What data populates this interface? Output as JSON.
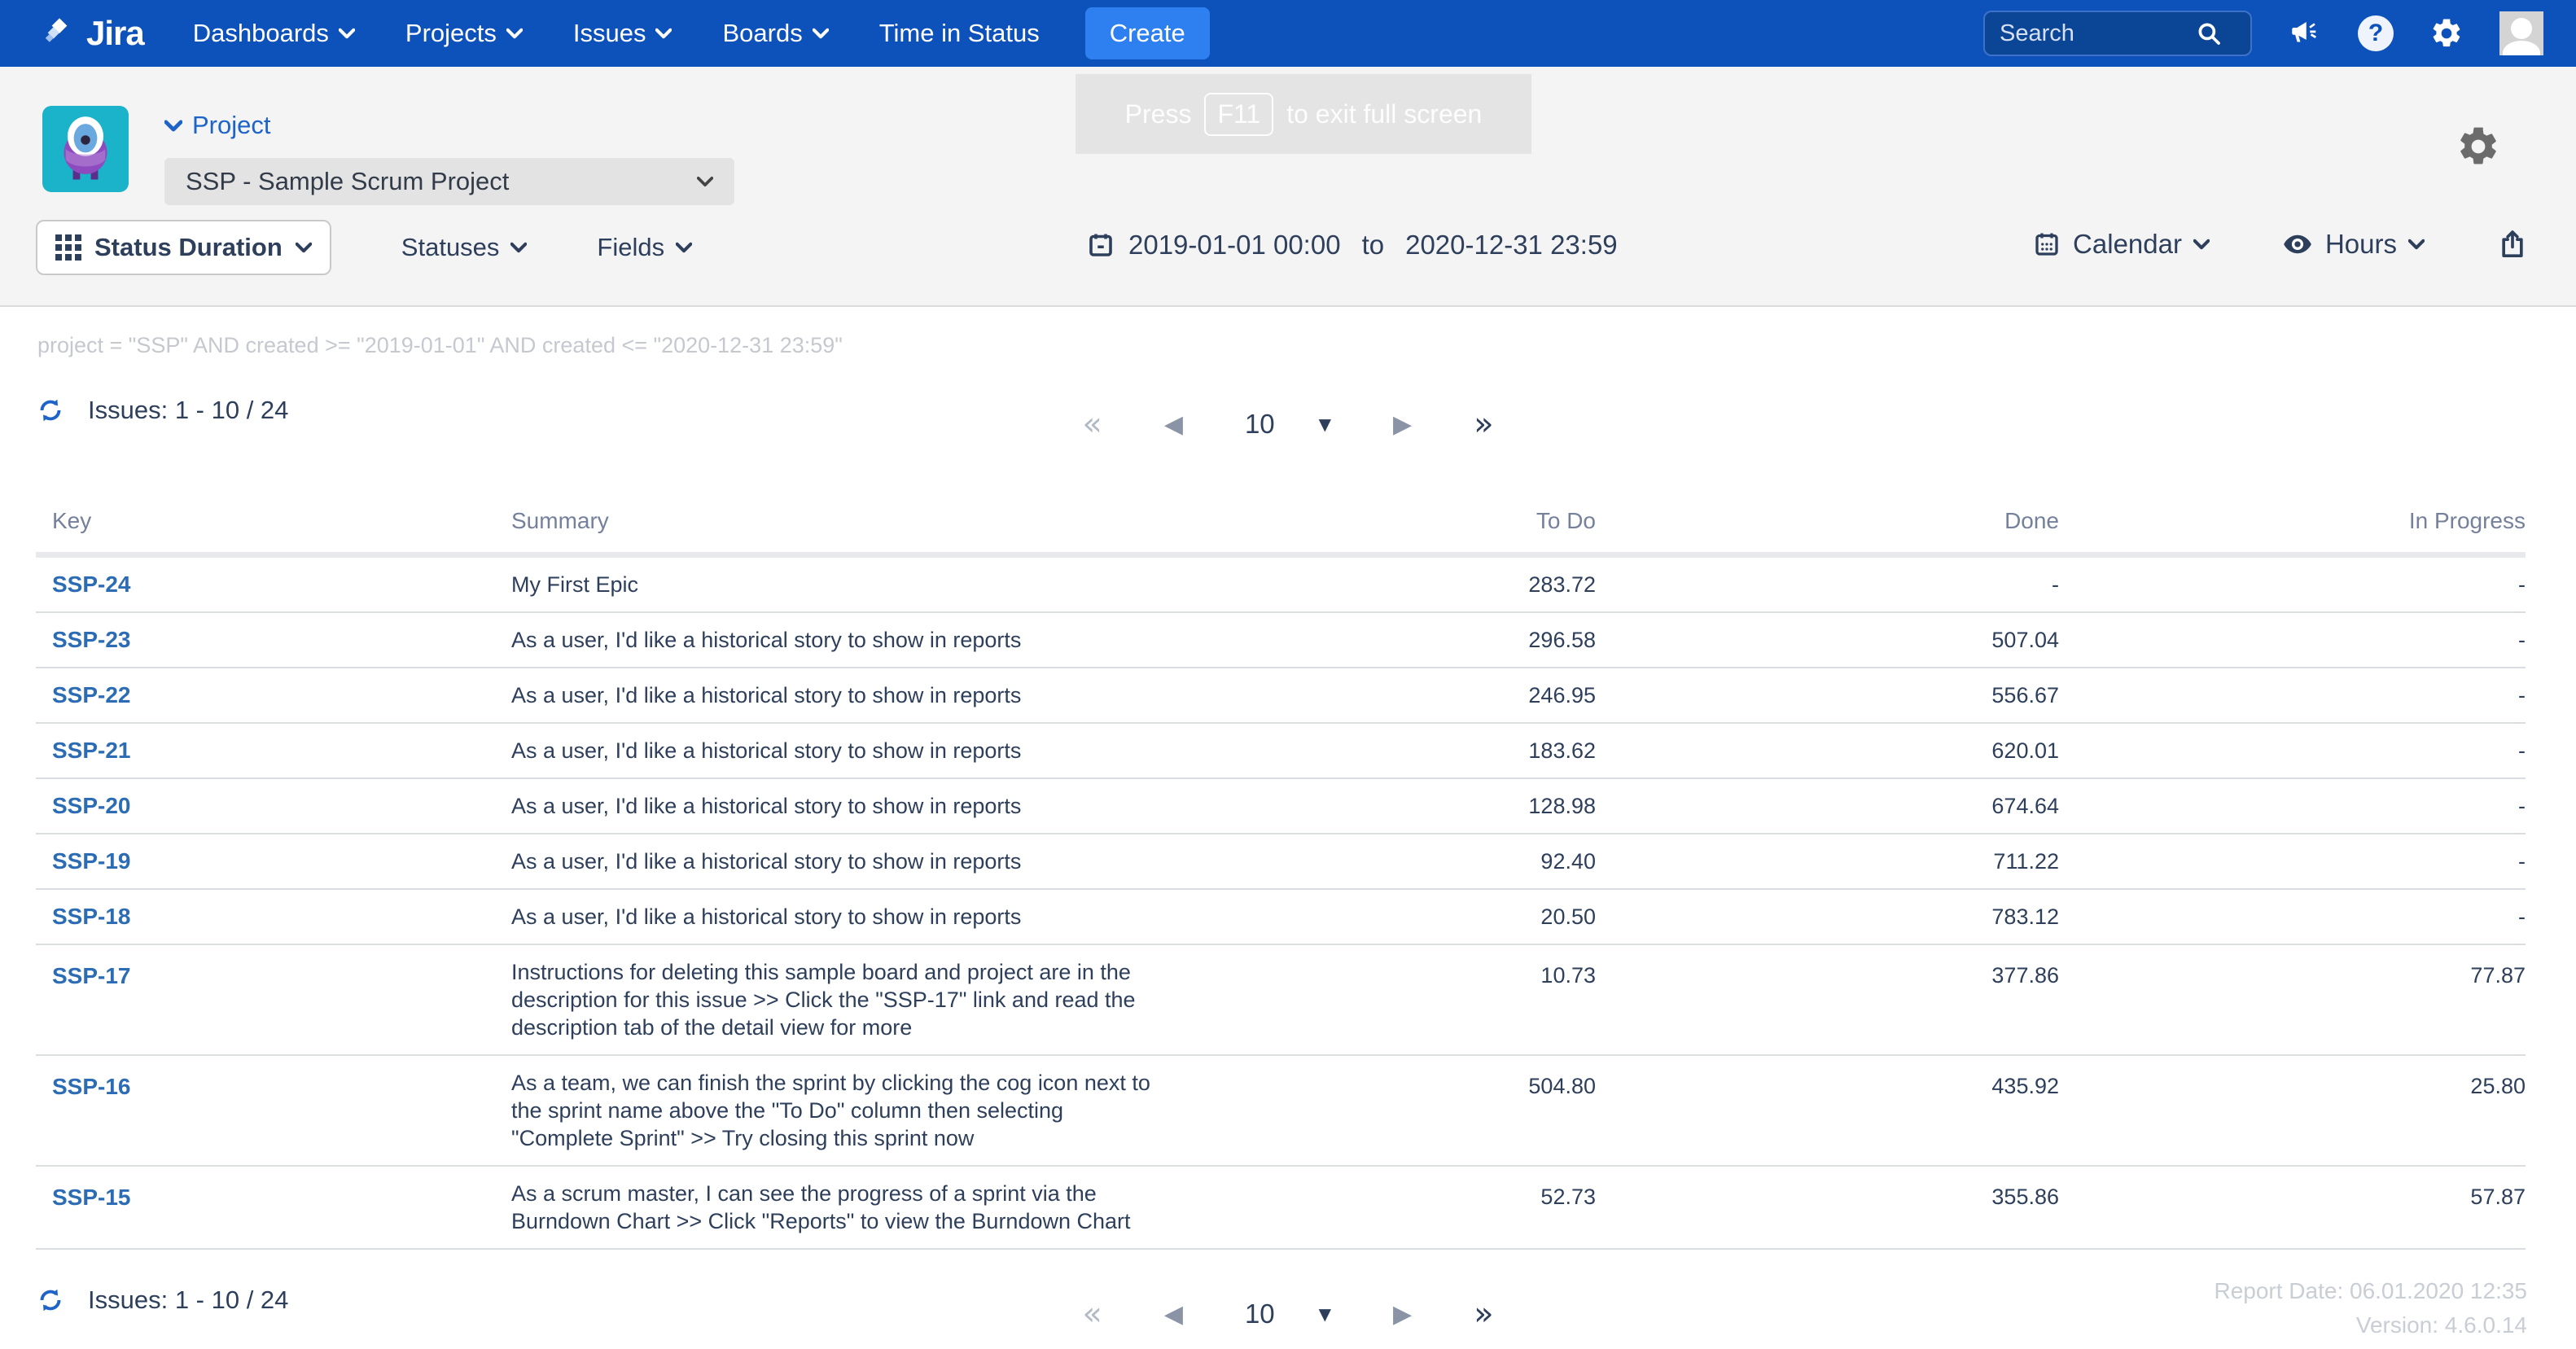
{
  "nav": {
    "brand": "Jira",
    "items": [
      {
        "label": "Dashboards"
      },
      {
        "label": "Projects"
      },
      {
        "label": "Issues"
      },
      {
        "label": "Boards"
      },
      {
        "label": "Time in Status"
      }
    ],
    "create_label": "Create",
    "search_placeholder": "Search"
  },
  "fullscreen_toast": {
    "pre": "Press",
    "key": "F11",
    "post": "to exit full screen"
  },
  "project": {
    "label": "Project",
    "selected": "SSP - Sample Scrum Project"
  },
  "toolbar": {
    "report_type": "Status Duration",
    "statuses_label": "Statuses",
    "fields_label": "Fields",
    "date_from": "2019-01-01 00:00",
    "to_word": "to",
    "date_to": "2020-12-31 23:59",
    "calendar_label": "Calendar",
    "hours_label": "Hours"
  },
  "query": "project = \"SSP\" AND created >= \"2019-01-01\" AND created <= \"2020-12-31 23:59\"",
  "issues_count": "Issues: 1 - 10 / 24",
  "pagination": {
    "page_size": "10",
    "first": "«",
    "prev": "◀",
    "next": "▶",
    "last": "»",
    "caret": "▼"
  },
  "table": {
    "columns": {
      "key": "Key",
      "summary": "Summary",
      "todo": "To Do",
      "done": "Done",
      "inprogress": "In Progress"
    },
    "rows": [
      {
        "key": "SSP-24",
        "summary": "My First Epic",
        "todo": "283.72",
        "done": "-",
        "inprog": "-"
      },
      {
        "key": "SSP-23",
        "summary": "As a user, I'd like a historical story to show in reports",
        "todo": "296.58",
        "done": "507.04",
        "inprog": "-"
      },
      {
        "key": "SSP-22",
        "summary": "As a user, I'd like a historical story to show in reports",
        "todo": "246.95",
        "done": "556.67",
        "inprog": "-"
      },
      {
        "key": "SSP-21",
        "summary": "As a user, I'd like a historical story to show in reports",
        "todo": "183.62",
        "done": "620.01",
        "inprog": "-"
      },
      {
        "key": "SSP-20",
        "summary": "As a user, I'd like a historical story to show in reports",
        "todo": "128.98",
        "done": "674.64",
        "inprog": "-"
      },
      {
        "key": "SSP-19",
        "summary": "As a user, I'd like a historical story to show in reports",
        "todo": "92.40",
        "done": "711.22",
        "inprog": "-"
      },
      {
        "key": "SSP-18",
        "summary": "As a user, I'd like a historical story to show in reports",
        "todo": "20.50",
        "done": "783.12",
        "inprog": "-"
      },
      {
        "key": "SSP-17",
        "summary": "Instructions for deleting this sample board and project are in the description for this issue >> Click the \"SSP-17\" link and read the description tab of the detail view for more",
        "todo": "10.73",
        "done": "377.86",
        "inprog": "77.87"
      },
      {
        "key": "SSP-16",
        "summary": "As a team, we can finish the sprint by clicking the cog icon next to the sprint name above the \"To Do\" column then selecting \"Complete Sprint\" >> Try closing this sprint now",
        "todo": "504.80",
        "done": "435.92",
        "inprog": "25.80"
      },
      {
        "key": "SSP-15",
        "summary": "As a scrum master, I can see the progress of a sprint via the Burndown Chart >> Click \"Reports\" to view the Burndown Chart",
        "todo": "52.73",
        "done": "355.86",
        "inprog": "57.87"
      }
    ]
  },
  "footer": {
    "report_date": "Report Date: 06.01.2020 12:35",
    "version": "Version: 4.6.0.14"
  },
  "colors": {
    "navbar": "#0d51ba",
    "create": "#2e80f0",
    "link": "#2b6cb5",
    "accent": "#1d63c8"
  }
}
